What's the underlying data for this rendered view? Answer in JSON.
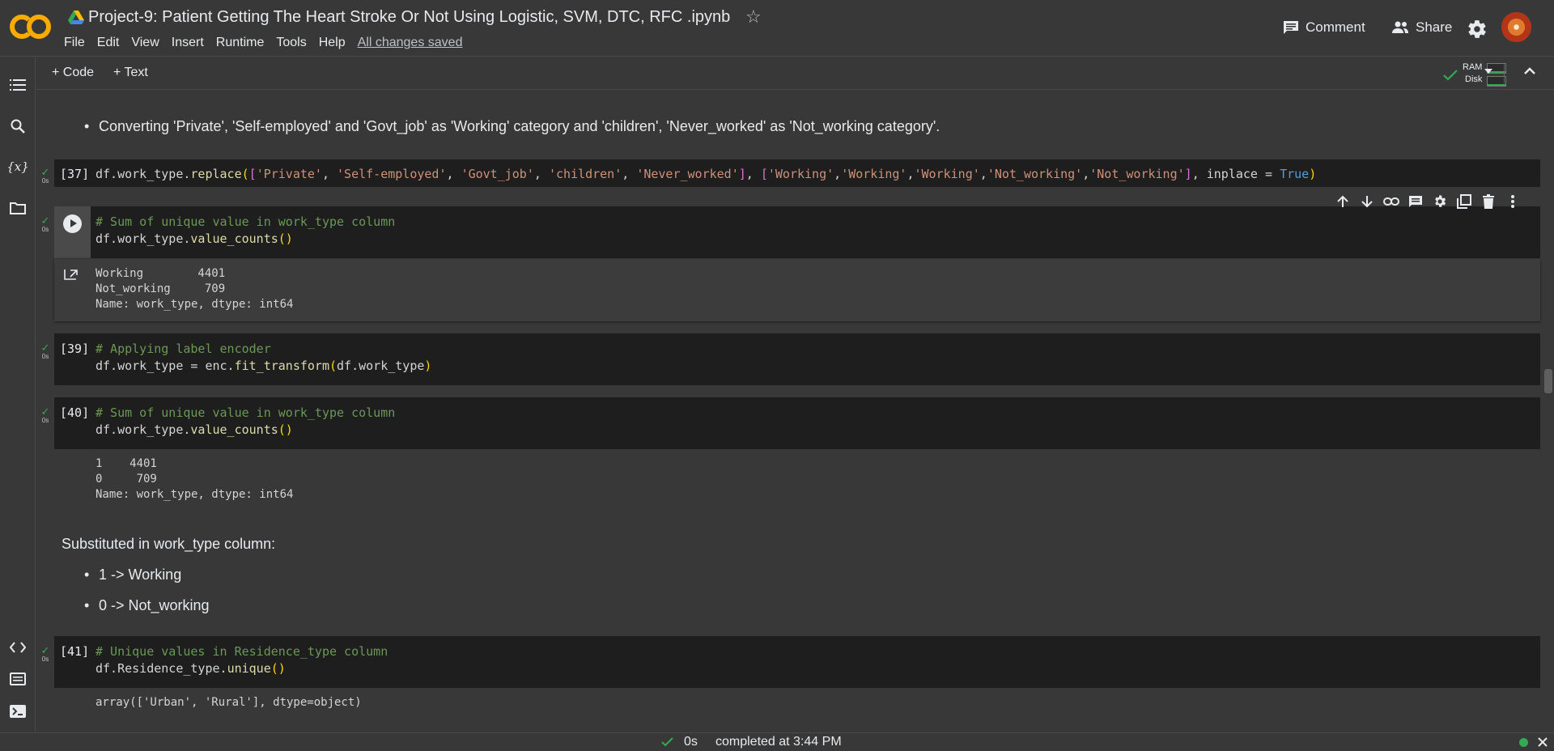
{
  "header": {
    "logo_text": "CO",
    "title": "Project-9: Patient Getting The Heart Stroke Or Not Using Logistic,  SVM, DTC, RFC .ipynb",
    "menu": [
      "File",
      "Edit",
      "View",
      "Insert",
      "Runtime",
      "Tools",
      "Help"
    ],
    "saved_status": "All changes saved",
    "comment_label": "Comment",
    "share_label": "Share"
  },
  "toolbar": {
    "code_label": "+ Code",
    "text_label": "+ Text",
    "ram_label": "RAM",
    "disk_label": "Disk"
  },
  "content": {
    "md1": "Converting 'Private', 'Self-employed' and 'Govt_job' as 'Working' category and 'children', 'Never_worked' as 'Not_working category'.",
    "cell37": {
      "count": "[37]",
      "secs": "0s"
    },
    "cell38": {
      "secs": "0s",
      "line1": "# Sum of unique value in work_type column",
      "out": [
        "Working        4401",
        "Not_working     709",
        "Name: work_type, dtype: int64"
      ]
    },
    "cell39": {
      "count": "[39]",
      "secs": "0s",
      "line1": "# Applying label encoder"
    },
    "cell40": {
      "count": "[40]",
      "secs": "0s",
      "line1": "# Sum of unique value in work_type column",
      "out": [
        "1    4401",
        "0     709",
        "Name: work_type, dtype: int64"
      ]
    },
    "md2": {
      "heading": "Substituted in work_type column:",
      "bullets": [
        "1 -> Working",
        "0 -> Not_working"
      ]
    },
    "cell41": {
      "count": "[41]",
      "secs": "0s",
      "line1": "# Unique values in Residence_type column",
      "out": "array(['Urban', 'Rural'], dtype=object)"
    }
  },
  "statusbar": {
    "duration": "0s",
    "completed": "completed at 3:44 PM"
  },
  "colors": {
    "background": "#383838",
    "code_bg": "#1e1e1e",
    "success": "#34a853",
    "logo_orange": "#f9ab00"
  }
}
